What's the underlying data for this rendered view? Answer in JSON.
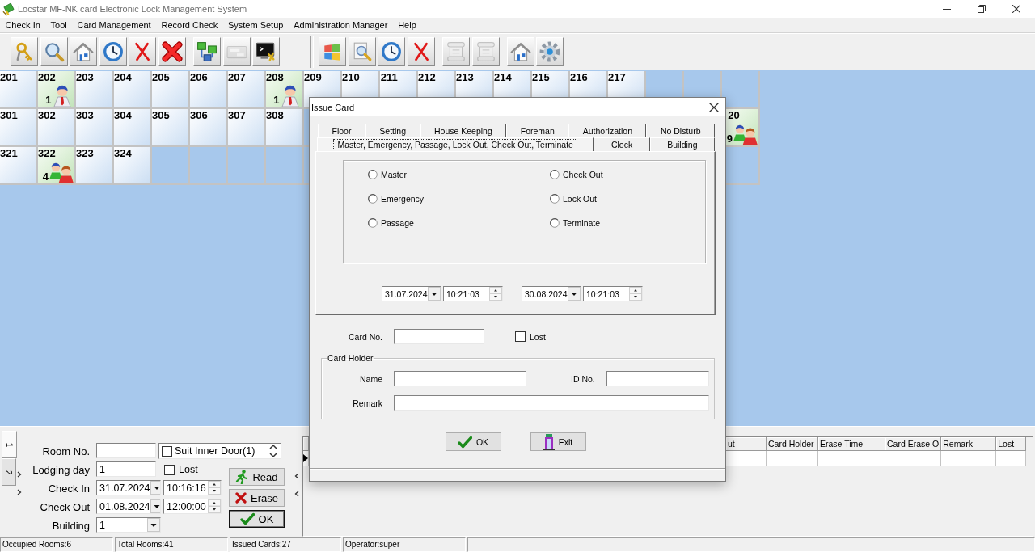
{
  "window": {
    "title": "Locstar MF-NK card Electronic Lock Management System"
  },
  "menu": [
    "Check In",
    "Tool",
    "Card Management",
    "Record Check",
    "System Setup",
    "Administration Manager",
    "Help"
  ],
  "toolbar": {
    "groups": [
      {
        "clusters": [
          {
            "buttons": [
              {
                "kind": "keys",
                "disabled": false
              },
              {
                "kind": "search",
                "disabled": false
              },
              {
                "kind": "house",
                "disabled": false
              },
              {
                "kind": "clock",
                "disabled": false
              },
              {
                "kind": "cross",
                "disabled": false
              },
              {
                "kind": "bold-cross",
                "disabled": false
              }
            ]
          },
          {
            "buttons": [
              {
                "kind": "network",
                "disabled": false
              },
              {
                "kind": "card",
                "disabled": true
              },
              {
                "kind": "terminal",
                "disabled": false
              }
            ]
          }
        ]
      },
      {
        "clusters": [
          {
            "buttons": [
              {
                "kind": "tiles",
                "disabled": false
              },
              {
                "kind": "search-page",
                "disabled": false
              },
              {
                "kind": "clock",
                "disabled": false
              },
              {
                "kind": "cross",
                "disabled": false
              }
            ]
          },
          {
            "buttons": [
              {
                "kind": "scroll",
                "disabled": true
              },
              {
                "kind": "scroll",
                "disabled": true
              }
            ]
          },
          {
            "buttons": [
              {
                "kind": "house",
                "disabled": false
              },
              {
                "kind": "gear",
                "disabled": false
              }
            ]
          }
        ]
      }
    ]
  },
  "room_grid": {
    "rows": [
      {
        "cells": [
          {
            "kind": "room",
            "label": "201",
            "occupied": false
          },
          {
            "kind": "room",
            "label": "202",
            "occupied": true,
            "guests": {
              "kind": "single",
              "count": "1"
            }
          },
          {
            "kind": "room",
            "label": "203",
            "occupied": false
          },
          {
            "kind": "room",
            "label": "204",
            "occupied": false
          },
          {
            "kind": "room",
            "label": "205",
            "occupied": false
          },
          {
            "kind": "room",
            "label": "206",
            "occupied": false
          },
          {
            "kind": "room",
            "label": "207",
            "occupied": false
          },
          {
            "kind": "room",
            "label": "208",
            "occupied": true,
            "guests": {
              "kind": "single",
              "count": "1"
            }
          },
          {
            "kind": "room",
            "label": "209",
            "occupied": false
          },
          {
            "kind": "room",
            "label": "210",
            "occupied": false
          },
          {
            "kind": "room",
            "label": "211",
            "occupied": false
          },
          {
            "kind": "room",
            "label": "212",
            "occupied": false
          },
          {
            "kind": "room",
            "label": "213",
            "occupied": false
          },
          {
            "kind": "room",
            "label": "214",
            "occupied": false
          },
          {
            "kind": "room",
            "label": "215",
            "occupied": false
          },
          {
            "kind": "room",
            "label": "216",
            "occupied": false
          },
          {
            "kind": "room",
            "label": "217",
            "occupied": false
          },
          {
            "kind": "empty"
          },
          {
            "kind": "empty"
          },
          {
            "kind": "empty"
          }
        ]
      },
      {
        "cells": [
          {
            "kind": "room",
            "label": "301",
            "occupied": false
          },
          {
            "kind": "room",
            "label": "302",
            "occupied": false
          },
          {
            "kind": "room",
            "label": "303",
            "occupied": false
          },
          {
            "kind": "room",
            "label": "304",
            "occupied": false
          },
          {
            "kind": "room",
            "label": "305",
            "occupied": false
          },
          {
            "kind": "room",
            "label": "306",
            "occupied": false
          },
          {
            "kind": "room",
            "label": "307",
            "occupied": false
          },
          {
            "kind": "room",
            "label": "308",
            "occupied": false
          },
          {
            "kind": "covered"
          },
          {
            "kind": "covered"
          },
          {
            "kind": "covered"
          },
          {
            "kind": "covered"
          },
          {
            "kind": "covered"
          },
          {
            "kind": "covered"
          },
          {
            "kind": "covered"
          },
          {
            "kind": "covered"
          },
          {
            "kind": "covered"
          },
          {
            "kind": "covered"
          },
          {
            "kind": "covered"
          },
          {
            "kind": "room",
            "label": "20",
            "occupied": true,
            "guests": {
              "kind": "group",
              "count": "9"
            }
          }
        ]
      },
      {
        "cells": [
          {
            "kind": "room",
            "label": "321",
            "occupied": false
          },
          {
            "kind": "room",
            "label": "322",
            "occupied": true,
            "guests": {
              "kind": "group",
              "count": "4"
            }
          },
          {
            "kind": "room",
            "label": "323",
            "occupied": false
          },
          {
            "kind": "room",
            "label": "324",
            "occupied": false
          },
          {
            "kind": "empty"
          },
          {
            "kind": "empty"
          },
          {
            "kind": "empty"
          },
          {
            "kind": "empty"
          },
          {
            "kind": "covered"
          },
          {
            "kind": "covered"
          },
          {
            "kind": "covered"
          },
          {
            "kind": "covered"
          },
          {
            "kind": "covered"
          },
          {
            "kind": "covered"
          },
          {
            "kind": "covered"
          },
          {
            "kind": "covered"
          },
          {
            "kind": "covered"
          },
          {
            "kind": "covered"
          },
          {
            "kind": "covered"
          },
          {
            "kind": "empty"
          }
        ]
      }
    ]
  },
  "check_in_panel": {
    "side_tabs": [
      {
        "label": "1",
        "selected": true
      },
      {
        "label": "2",
        "selected": false
      }
    ],
    "room_no": {
      "label": "Room No."
    },
    "doors": [
      {
        "label": "Suit Inner Door(1)",
        "checked": false
      }
    ],
    "lodging_day": {
      "label": "Lodging day",
      "value": "1"
    },
    "lost": {
      "label": "Lost",
      "checked": false
    },
    "check_in": {
      "label": "Check In",
      "date": "31.07.2024",
      "time": "10:16:16"
    },
    "check_out": {
      "label": "Check Out",
      "date": "01.08.2024",
      "time": "12:00:00"
    },
    "building": {
      "label": "Building",
      "value": "1"
    },
    "buttons": [
      {
        "kind": "read",
        "label": "Read"
      },
      {
        "kind": "erase",
        "label": "Erase"
      },
      {
        "kind": "ok",
        "label": "OK"
      }
    ]
  },
  "card_table": {
    "columns": [
      "ut",
      "Card Holder",
      "Erase Time",
      "Card Erase O",
      "Remark",
      "Lost"
    ]
  },
  "status_bar": [
    "Occupied Rooms:6",
    "Total Rooms:41",
    "Issued Cards:27",
    "Operator:super"
  ],
  "dialog": {
    "title": "Issue Card",
    "tab_rows": [
      {
        "tabs": [
          {
            "label": "Floor",
            "selected": false
          },
          {
            "label": "Setting",
            "selected": false
          },
          {
            "label": "House Keeping",
            "selected": false
          },
          {
            "label": "Foreman",
            "selected": false
          },
          {
            "label": "Authorization",
            "selected": false
          },
          {
            "label": "No Disturb",
            "selected": false
          }
        ]
      },
      {
        "tabs": [
          {
            "label": "Master, Emergency, Passage, Lock Out, Check Out, Terminate",
            "selected": true
          },
          {
            "label": "Clock",
            "selected": false
          },
          {
            "label": "Building",
            "selected": false
          }
        ]
      }
    ],
    "card_types": [
      {
        "label": "Master",
        "selected": false
      },
      {
        "label": "Check Out",
        "selected": false
      },
      {
        "label": "Emergency",
        "selected": false
      },
      {
        "label": "Lock Out",
        "selected": false
      },
      {
        "label": "Passage",
        "selected": false
      },
      {
        "label": "Terminate",
        "selected": false
      }
    ],
    "period": [
      {
        "date": "31.07.2024",
        "time": "10:21:03"
      },
      {
        "date": "30.08.2024",
        "time": "10:21:03"
      }
    ],
    "card_no": {
      "label": "Card No."
    },
    "lost": {
      "label": "Lost",
      "checked": false
    },
    "card_holder": {
      "title": "Card Holder",
      "name": {
        "label": "Name"
      },
      "id_no": {
        "label": "ID No."
      },
      "remark": {
        "label": "Remark"
      }
    },
    "buttons": [
      {
        "kind": "ok",
        "label": "OK"
      },
      {
        "kind": "exit",
        "label": "Exit"
      }
    ]
  }
}
